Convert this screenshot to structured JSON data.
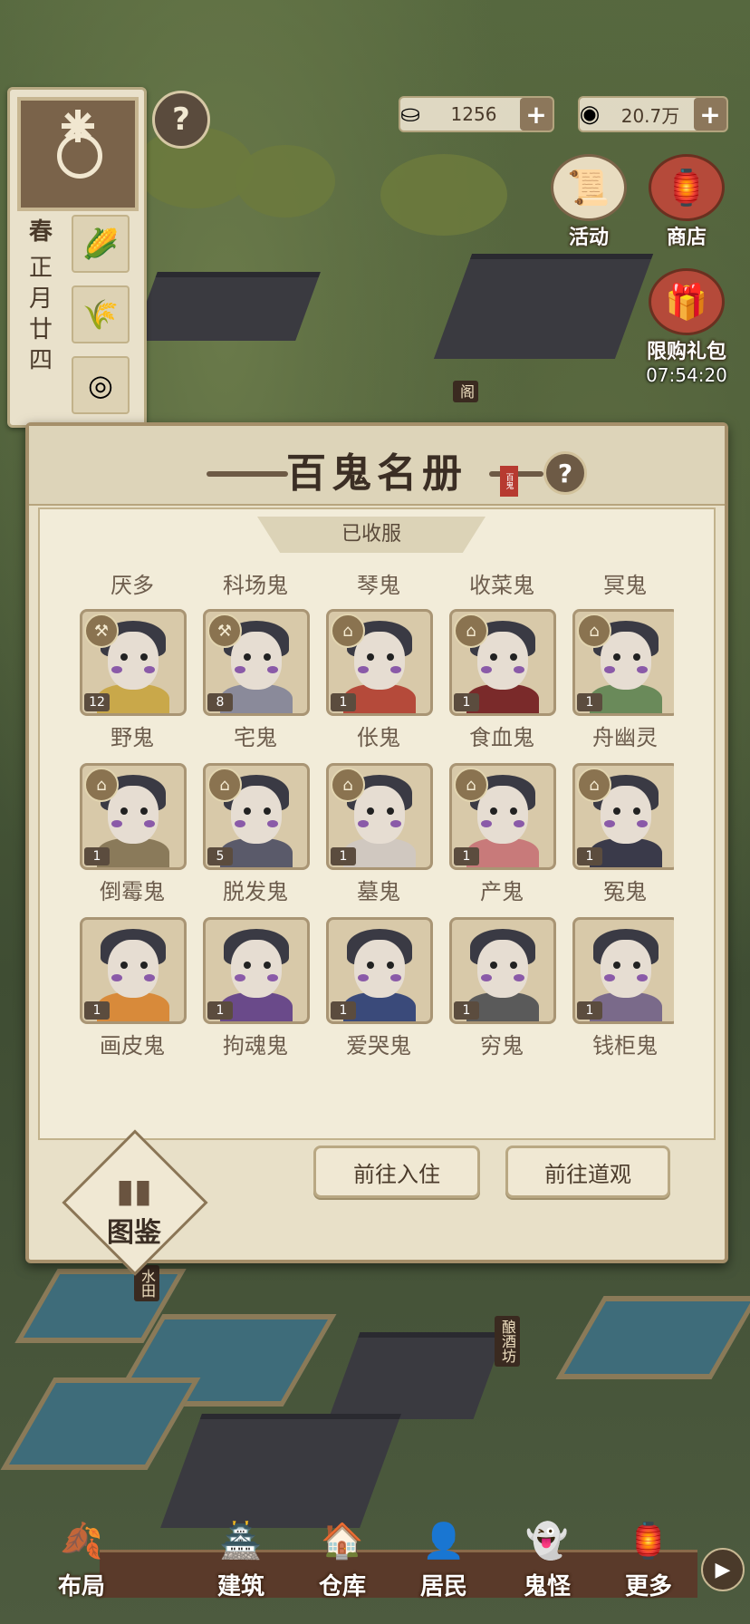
{
  "hud": {
    "season": "春",
    "date": "正月廿四",
    "season_icons": [
      "corn-icon",
      "wheat-icon",
      "coin-pile-icon"
    ],
    "help": "?",
    "silver_value": "1256",
    "copper_value": "20.7万",
    "plus": "+"
  },
  "side_buttons": {
    "activity_label": "活动",
    "shop_label": "商店",
    "limited_gift_label": "限购礼包",
    "limited_gift_timer": "07:54:20"
  },
  "map_labels": {
    "paddy": "水田",
    "brewery": "酿酒坊",
    "pavilion": "阁"
  },
  "modal": {
    "title": "百鬼名册",
    "seal": "百鬼",
    "help": "?",
    "tab": "已收服",
    "partial_row": [
      "厌多",
      "科场鬼",
      "琴鬼",
      "收菜鬼",
      "冥鬼"
    ],
    "ghosts": [
      {
        "name": "野鬼",
        "count": "12",
        "badge": "hammer"
      },
      {
        "name": "宅鬼",
        "count": "8",
        "badge": "hammer"
      },
      {
        "name": "伥鬼",
        "count": "1",
        "badge": "house"
      },
      {
        "name": "食血鬼",
        "count": "1",
        "badge": "house"
      },
      {
        "name": "舟幽灵",
        "count": "1",
        "badge": "house"
      },
      {
        "name": "倒霉鬼",
        "count": "1",
        "badge": "house"
      },
      {
        "name": "脱发鬼",
        "count": "5",
        "badge": "house"
      },
      {
        "name": "墓鬼",
        "count": "1",
        "badge": "house"
      },
      {
        "name": "产鬼",
        "count": "1",
        "badge": "house"
      },
      {
        "name": "冤鬼",
        "count": "1",
        "badge": "house"
      },
      {
        "name": "画皮鬼",
        "count": "1",
        "badge": ""
      },
      {
        "name": "拘魂鬼",
        "count": "1",
        "badge": ""
      },
      {
        "name": "爱哭鬼",
        "count": "1",
        "badge": ""
      },
      {
        "name": "穷鬼",
        "count": "1",
        "badge": ""
      },
      {
        "name": "钱柜鬼",
        "count": "1",
        "badge": ""
      }
    ],
    "btn_move_in": "前往入住",
    "btn_temple": "前往道观",
    "codex_label": "图鉴"
  },
  "nav": {
    "layout": "布局",
    "build": "建筑",
    "warehouse": "仓库",
    "residents": "居民",
    "ghosts": "鬼怪",
    "more": "更多",
    "arrow": "▶"
  },
  "colors": {
    "panel": "#e8e0c8",
    "accent": "#8c775b",
    "title": "#3b2e24"
  }
}
